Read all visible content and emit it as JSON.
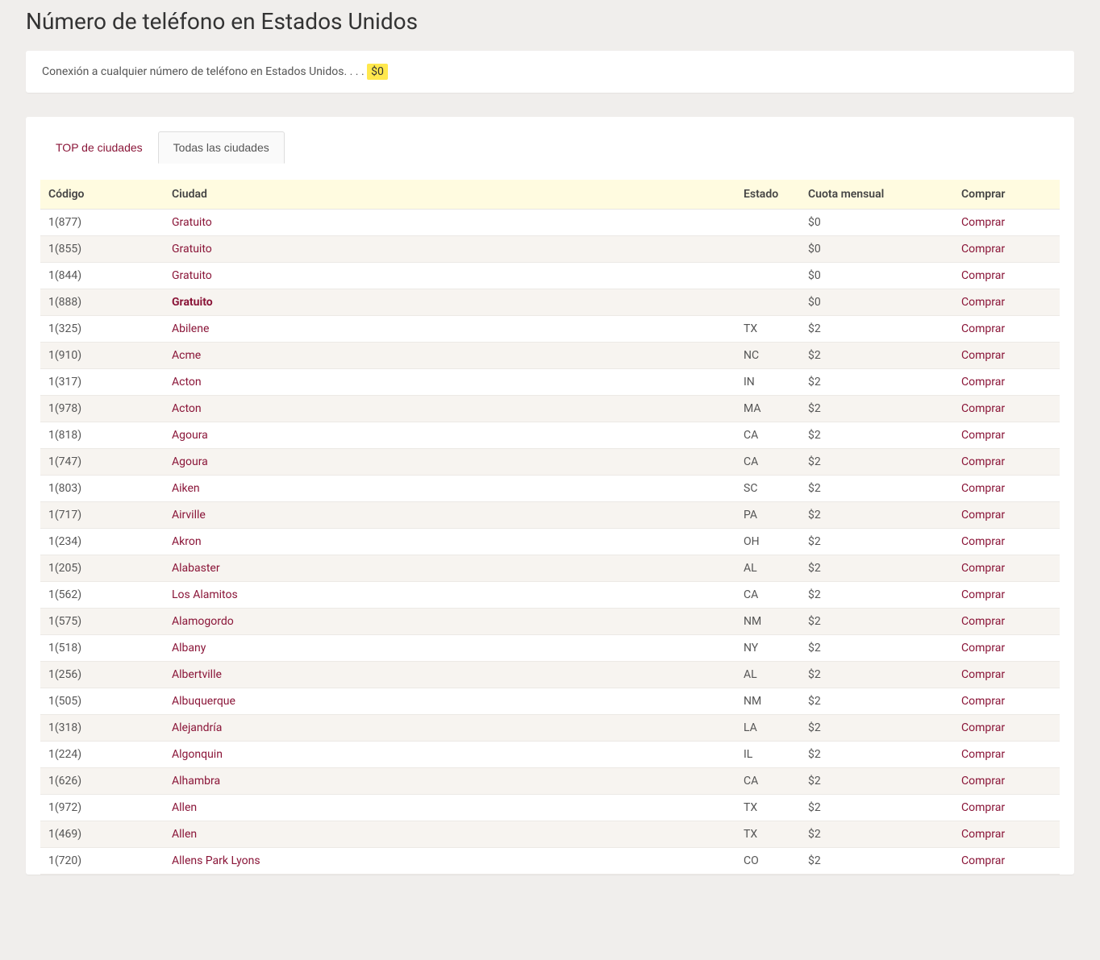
{
  "page": {
    "title": "Número de teléfono en Estados Unidos",
    "info_text": "Conexión a cualquier número de teléfono en Estados Unidos. . . . ",
    "info_price": "$0"
  },
  "tabs": {
    "top_cities": "TOP de ciudades",
    "all_cities": "Todas las ciudades"
  },
  "table": {
    "headers": {
      "code": "Código",
      "city": "Ciudad",
      "state": "Estado",
      "fee": "Cuota mensual",
      "buy": "Comprar"
    },
    "buy_label": "Comprar",
    "rows": [
      {
        "code": "1(877)",
        "city": "Gratuito",
        "state": "",
        "fee": "$0",
        "bold": false
      },
      {
        "code": "1(855)",
        "city": "Gratuito",
        "state": "",
        "fee": "$0",
        "bold": false
      },
      {
        "code": "1(844)",
        "city": "Gratuito",
        "state": "",
        "fee": "$0",
        "bold": false
      },
      {
        "code": "1(888)",
        "city": "Gratuito",
        "state": "",
        "fee": "$0",
        "bold": true
      },
      {
        "code": "1(325)",
        "city": "Abilene",
        "state": "TX",
        "fee": "$2",
        "bold": false
      },
      {
        "code": "1(910)",
        "city": "Acme",
        "state": "NC",
        "fee": "$2",
        "bold": false
      },
      {
        "code": "1(317)",
        "city": "Acton",
        "state": "IN",
        "fee": "$2",
        "bold": false
      },
      {
        "code": "1(978)",
        "city": "Acton",
        "state": "MA",
        "fee": "$2",
        "bold": false
      },
      {
        "code": "1(818)",
        "city": "Agoura",
        "state": "CA",
        "fee": "$2",
        "bold": false
      },
      {
        "code": "1(747)",
        "city": "Agoura",
        "state": "CA",
        "fee": "$2",
        "bold": false
      },
      {
        "code": "1(803)",
        "city": "Aiken",
        "state": "SC",
        "fee": "$2",
        "bold": false
      },
      {
        "code": "1(717)",
        "city": "Airville",
        "state": "PA",
        "fee": "$2",
        "bold": false
      },
      {
        "code": "1(234)",
        "city": "Akron",
        "state": "OH",
        "fee": "$2",
        "bold": false
      },
      {
        "code": "1(205)",
        "city": "Alabaster",
        "state": "AL",
        "fee": "$2",
        "bold": false
      },
      {
        "code": "1(562)",
        "city": "Los Alamitos",
        "state": "CA",
        "fee": "$2",
        "bold": false
      },
      {
        "code": "1(575)",
        "city": "Alamogordo",
        "state": "NM",
        "fee": "$2",
        "bold": false
      },
      {
        "code": "1(518)",
        "city": "Albany",
        "state": "NY",
        "fee": "$2",
        "bold": false
      },
      {
        "code": "1(256)",
        "city": "Albertville",
        "state": "AL",
        "fee": "$2",
        "bold": false
      },
      {
        "code": "1(505)",
        "city": "Albuquerque",
        "state": "NM",
        "fee": "$2",
        "bold": false
      },
      {
        "code": "1(318)",
        "city": "Alejandría",
        "state": "LA",
        "fee": "$2",
        "bold": false
      },
      {
        "code": "1(224)",
        "city": "Algonquin",
        "state": "IL",
        "fee": "$2",
        "bold": false
      },
      {
        "code": "1(626)",
        "city": "Alhambra",
        "state": "CA",
        "fee": "$2",
        "bold": false
      },
      {
        "code": "1(972)",
        "city": "Allen",
        "state": "TX",
        "fee": "$2",
        "bold": false
      },
      {
        "code": "1(469)",
        "city": "Allen",
        "state": "TX",
        "fee": "$2",
        "bold": false
      },
      {
        "code": "1(720)",
        "city": "Allens Park Lyons",
        "state": "CO",
        "fee": "$2",
        "bold": false
      }
    ]
  }
}
